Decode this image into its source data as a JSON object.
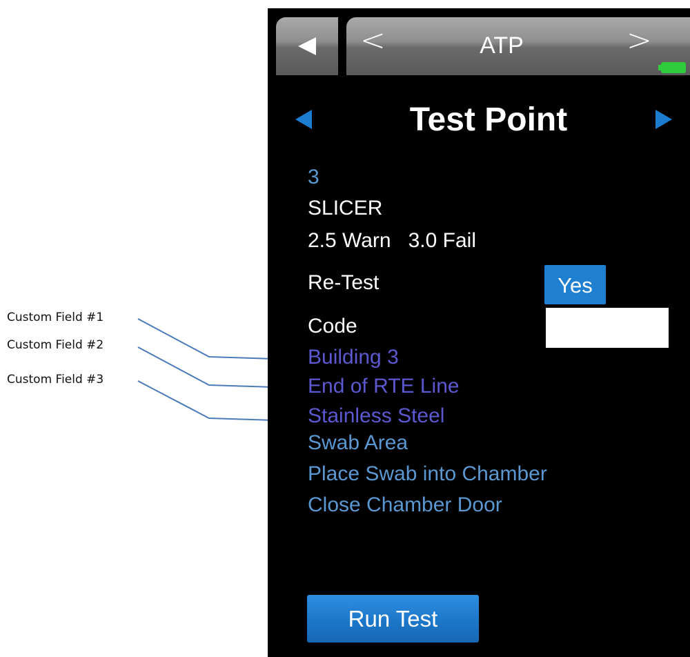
{
  "callouts": [
    {
      "label": "Custom Field #1"
    },
    {
      "label": "Custom Field #2"
    },
    {
      "label": "Custom Field #3"
    }
  ],
  "header": {
    "title": "ATP",
    "prev_label": "<",
    "next_label": ">"
  },
  "icons": {
    "back": "back-arrow-icon",
    "battery": "battery-icon",
    "prev_point": "triangle-left-icon",
    "next_point": "triangle-right-icon"
  },
  "page": {
    "title": "Test Point"
  },
  "test_point": {
    "number": "3",
    "name": "SLICER",
    "thresholds": "2.5 Warn   3.0 Fail"
  },
  "retest": {
    "label": "Re-Test",
    "button_label": "Yes"
  },
  "code": {
    "label": "Code",
    "value": ""
  },
  "custom_fields": [
    "Building 3",
    "End of RTE Line",
    "Stainless Steel"
  ],
  "instructions": [
    "Swab Area",
    "Place Swab into Chamber",
    "Close Chamber Door"
  ],
  "run_button": {
    "label": "Run Test"
  },
  "colors": {
    "screen_background": "#000000",
    "accent_blue": "#1f7fd1",
    "info_text": "#5b98d2",
    "custom_field_text": "#5c58d0",
    "battery": "#2fcb3c",
    "callout_line": "#4a7ab8"
  }
}
